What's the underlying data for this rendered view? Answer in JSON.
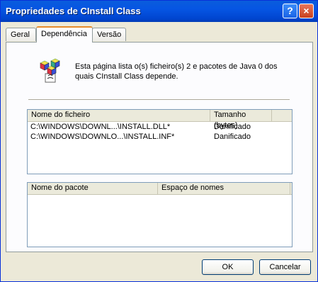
{
  "window": {
    "title": "Propriedades de CInstall Class"
  },
  "tabs": [
    {
      "label": "Geral"
    },
    {
      "label": "Dependência"
    },
    {
      "label": "Versão"
    }
  ],
  "description": "Esta página lista o(s) ficheiro(s) 2 e pacotes de Java 0 dos quais CInstall Class depende.",
  "files": {
    "columns": [
      "Nome do ficheiro",
      "Tamanho (bytes)"
    ],
    "rows": [
      {
        "name": "C:\\WINDOWS\\DOWNL...\\INSTALL.DLL*",
        "size": "Danificado"
      },
      {
        "name": "C:\\WINDOWS\\DOWNLO...\\INSTALL.INF*",
        "size": "Danificado"
      }
    ]
  },
  "packages": {
    "columns": [
      "Nome do pacote",
      "Espaço de nomes"
    ],
    "rows": []
  },
  "buttons": {
    "ok": "OK",
    "cancel": "Cancelar",
    "help": "?",
    "close": "×"
  }
}
